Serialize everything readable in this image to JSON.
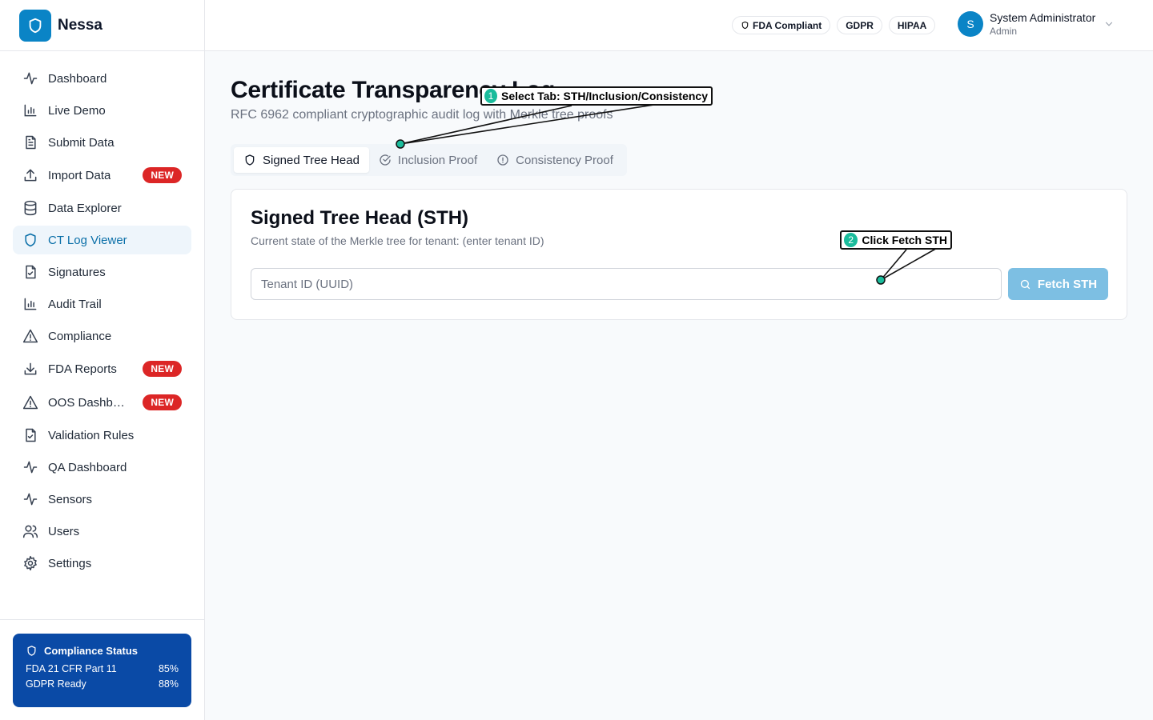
{
  "app": {
    "name": "Nessa"
  },
  "sidebar": {
    "items": [
      {
        "label": "Dashboard",
        "icon": "activity-icon",
        "active": false
      },
      {
        "label": "Live Demo",
        "icon": "bar-chart-icon",
        "active": false
      },
      {
        "label": "Submit Data",
        "icon": "file-text-icon",
        "active": false
      },
      {
        "label": "Import Data",
        "icon": "upload-icon",
        "active": false,
        "badge": "NEW"
      },
      {
        "label": "Data Explorer",
        "icon": "database-icon",
        "active": false
      },
      {
        "label": "CT Log Viewer",
        "icon": "shield-icon",
        "active": true
      },
      {
        "label": "Signatures",
        "icon": "file-check-icon",
        "active": false
      },
      {
        "label": "Audit Trail",
        "icon": "bar-chart-icon",
        "active": false
      },
      {
        "label": "Compliance",
        "icon": "alert-triangle-icon",
        "active": false
      },
      {
        "label": "FDA Reports",
        "icon": "download-icon",
        "active": false,
        "badge": "NEW"
      },
      {
        "label": "OOS Dashboard",
        "icon": "alert-triangle-icon",
        "active": false,
        "badge": "NEW"
      },
      {
        "label": "Validation Rules",
        "icon": "file-check-icon",
        "active": false
      },
      {
        "label": "QA Dashboard",
        "icon": "activity-icon",
        "active": false
      },
      {
        "label": "Sensors",
        "icon": "activity-icon",
        "active": false
      },
      {
        "label": "Users",
        "icon": "users-icon",
        "active": false
      },
      {
        "label": "Settings",
        "icon": "gear-icon",
        "active": false
      }
    ],
    "compliance": {
      "title": "Compliance Status",
      "rows": [
        {
          "label": "FDA 21 CFR Part 11",
          "value": "85%"
        },
        {
          "label": "GDPR Ready",
          "value": "88%"
        }
      ]
    }
  },
  "header": {
    "chips": [
      "FDA Compliant",
      "GDPR",
      "HIPAA"
    ],
    "user": {
      "initial": "S",
      "name": "System Administrator",
      "role": "Admin"
    }
  },
  "main": {
    "title": "Certificate Transparency Log",
    "subtitle": "RFC 6962 compliant cryptographic audit log with Merkle tree proofs",
    "tabs": [
      {
        "label": "Signed Tree Head",
        "icon": "shield-icon",
        "active": true
      },
      {
        "label": "Inclusion Proof",
        "icon": "check-circle-icon",
        "active": false
      },
      {
        "label": "Consistency Proof",
        "icon": "alert-circle-icon",
        "active": false
      }
    ],
    "card": {
      "title": "Signed Tree Head (STH)",
      "description": "Current state of the Merkle tree for tenant: (enter tenant ID)",
      "input_placeholder": "Tenant ID (UUID)",
      "input_value": "",
      "button_label": "Fetch STH"
    }
  },
  "annotations": [
    {
      "number": "1",
      "text": "Select Tab: STH/Inclusion/Consistency"
    },
    {
      "number": "2",
      "text": "Click Fetch STH"
    }
  ],
  "colors": {
    "brand": "#0a84c6",
    "active_bg": "#eef5fb",
    "badge": "#dc2626",
    "compliance_card": "#0a4aa6",
    "button_disabled": "#7dbfe3",
    "annotation_marker": "#1abc9c"
  }
}
